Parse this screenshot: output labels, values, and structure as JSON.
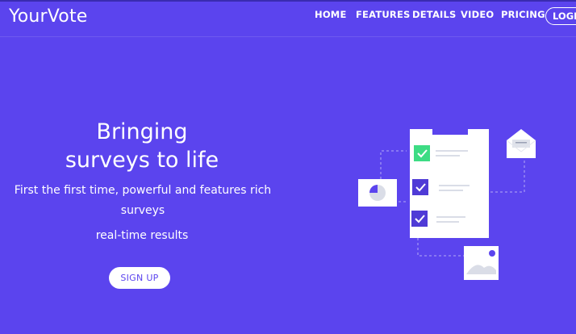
{
  "header": {
    "brand": "YourVote",
    "nav": {
      "home": "HOME",
      "features": "FEATURES",
      "details": "DETAILS",
      "video": "VIDEO",
      "pricing": "PRICING",
      "login": "LOGIN"
    }
  },
  "hero": {
    "title_line1": "Bringing",
    "title_line2": "surveys to life",
    "desc_line1": "First the first time, powerful and features rich",
    "desc_line2": "surveys",
    "realtime": "real-time results",
    "signup": "SIGN UP"
  },
  "colors": {
    "background": "#5b44ee",
    "accent_green": "#3ddc84",
    "checkbox": "#4f3bd6",
    "white": "#ffffff"
  },
  "icons": {
    "checkbox": "check-icon",
    "envelope": "envelope-icon",
    "pie_chart": "pie-chart-icon",
    "photo": "image-icon"
  }
}
